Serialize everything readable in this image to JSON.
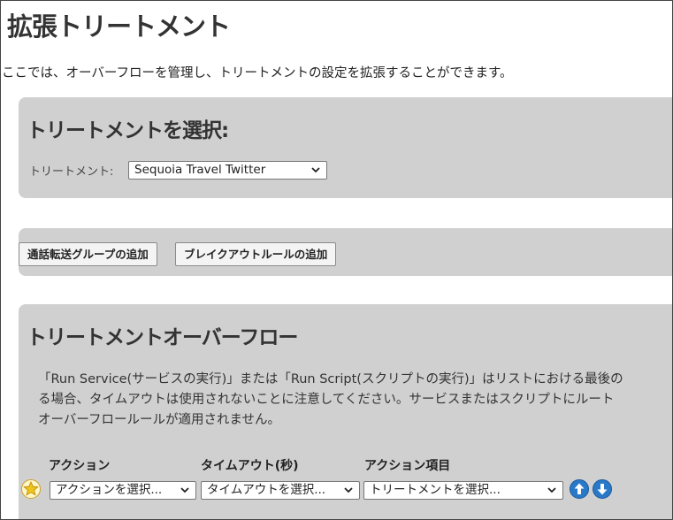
{
  "page": {
    "title": "拡張トリートメント",
    "intro": "ここでは、オーバーフローを管理し、トリートメントの設定を拡張することができます。"
  },
  "treatment_panel": {
    "heading": "トリートメントを選択:",
    "label": "トリートメント:",
    "selected": "Sequoia Travel Twitter"
  },
  "buttons": {
    "add_group": "通話転送グループの追加",
    "add_rule": "ブレイクアウトルールの追加"
  },
  "overflow_panel": {
    "heading": "トリートメントオーバーフロー",
    "desc_line1": "「Run Service(サービスの実行)」または「Run Script(スクリプトの実行)」はリストにおける最後の",
    "desc_line2": "る場合、タイムアウトは使用されないことに注意してください。サービスまたはスクリプトにルート",
    "desc_line3": "オーバーフロールールが適用されません。",
    "columns": {
      "action": "アクション",
      "timeout": "タイムアウト(秒)",
      "action_item": "アクション項目"
    },
    "row": {
      "action_select": "アクションを選択...",
      "timeout_select": "タイムアウトを選択...",
      "item_select": "トリートメントを選択..."
    }
  },
  "colors": {
    "panel": "#d0d0d0",
    "arrow": "#2a78c8",
    "star": "#f0c419"
  },
  "icons": [
    "star-icon",
    "chevron-down-icon",
    "arrow-up-icon",
    "arrow-down-icon"
  ]
}
